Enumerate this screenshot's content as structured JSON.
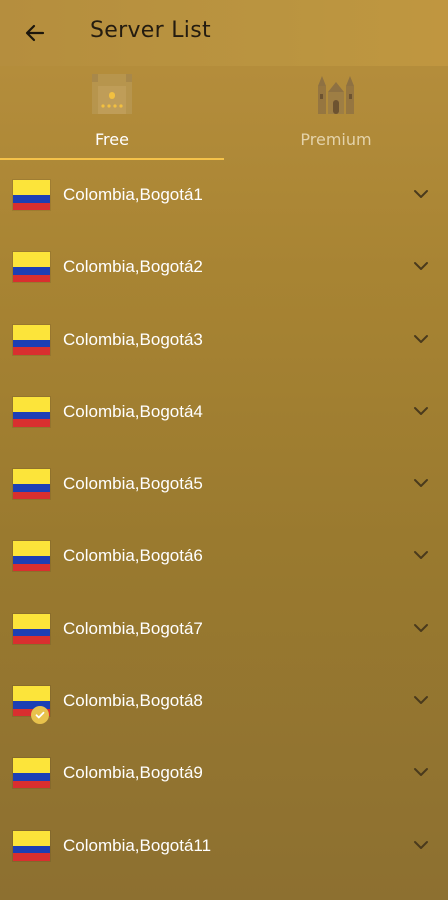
{
  "header": {
    "back_icon": "arrow-left-icon",
    "title": "Server List"
  },
  "tabs": [
    {
      "label": "Free",
      "icon": "castle-free-icon",
      "selected": true
    },
    {
      "label": "Premium",
      "icon": "castle-premium-icon",
      "selected": false
    }
  ],
  "colors": {
    "accent": "#f5c24a",
    "flag_yellow": "#fce43a",
    "flag_blue": "#1d3fb4",
    "flag_red": "#d92f2f"
  },
  "servers": [
    {
      "label": "Colombia,Bogotá1",
      "flag": "colombia-flag-icon",
      "selected": false
    },
    {
      "label": "Colombia,Bogotá2",
      "flag": "colombia-flag-icon",
      "selected": false
    },
    {
      "label": "Colombia,Bogotá3",
      "flag": "colombia-flag-icon",
      "selected": false
    },
    {
      "label": "Colombia,Bogotá4",
      "flag": "colombia-flag-icon",
      "selected": false
    },
    {
      "label": "Colombia,Bogotá5",
      "flag": "colombia-flag-icon",
      "selected": false
    },
    {
      "label": "Colombia,Bogotá6",
      "flag": "colombia-flag-icon",
      "selected": false
    },
    {
      "label": "Colombia,Bogotá7",
      "flag": "colombia-flag-icon",
      "selected": false
    },
    {
      "label": "Colombia,Bogotá8",
      "flag": "colombia-flag-icon",
      "selected": true
    },
    {
      "label": "Colombia,Bogotá9",
      "flag": "colombia-flag-icon",
      "selected": false
    },
    {
      "label": "Colombia,Bogotá11",
      "flag": "colombia-flag-icon",
      "selected": false
    }
  ]
}
